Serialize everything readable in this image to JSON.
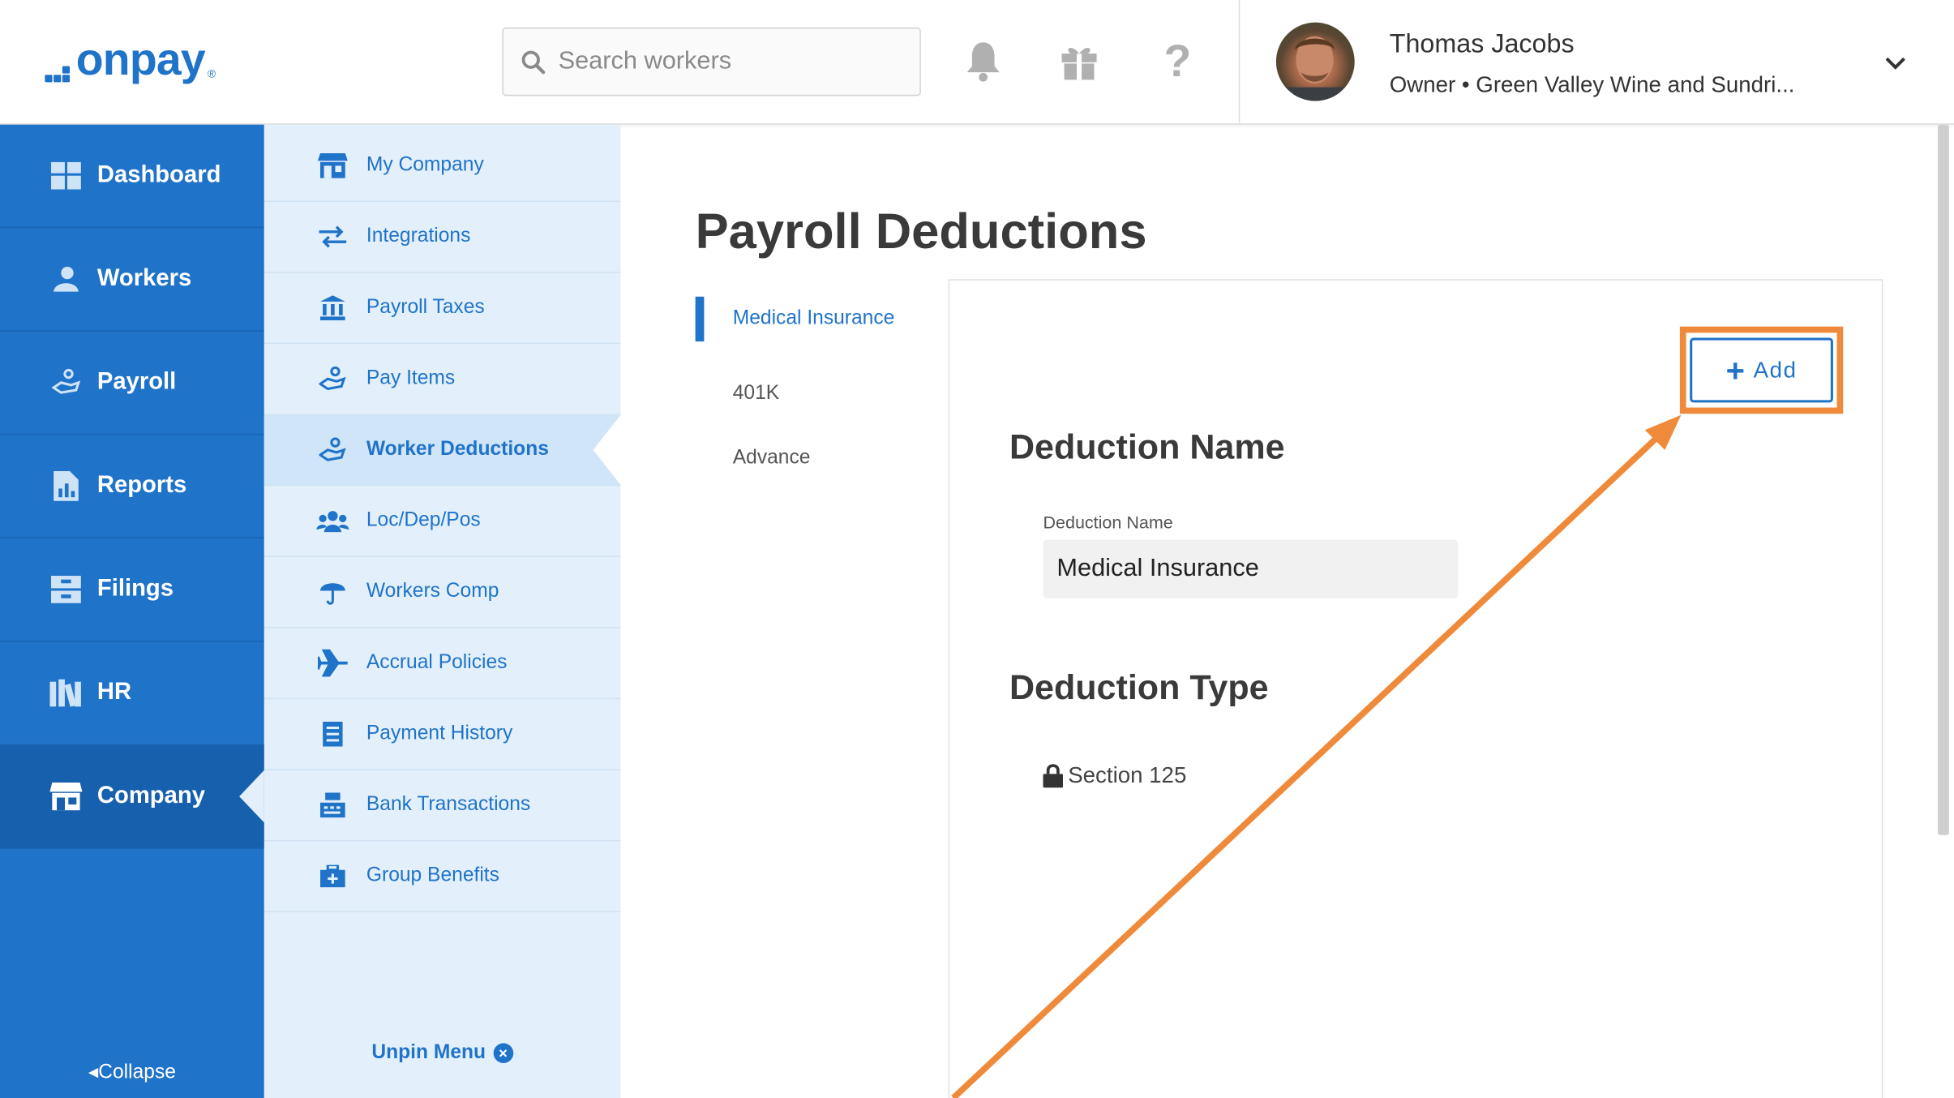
{
  "brand": {
    "logo_text": "onpay",
    "logo_mark": "®"
  },
  "header": {
    "search_placeholder": "Search workers",
    "icons": [
      "bell-icon",
      "gift-icon",
      "help-icon"
    ],
    "help_symbol": "?",
    "user": {
      "name": "Thomas Jacobs",
      "role": "Owner • Green Valley Wine and Sundri..."
    }
  },
  "nav": {
    "items": [
      {
        "label": "Dashboard",
        "icon": "dashboard-icon"
      },
      {
        "label": "Workers",
        "icon": "workers-icon"
      },
      {
        "label": "Payroll",
        "icon": "payroll-icon"
      },
      {
        "label": "Reports",
        "icon": "reports-icon"
      },
      {
        "label": "Filings",
        "icon": "filings-icon"
      },
      {
        "label": "HR",
        "icon": "hr-icon"
      },
      {
        "label": "Company",
        "icon": "company-icon"
      }
    ],
    "active": "Company",
    "collapse_label": "Collapse"
  },
  "submenu": {
    "items": [
      {
        "label": "My Company",
        "icon": "store-icon"
      },
      {
        "label": "Integrations",
        "icon": "arrows-icon"
      },
      {
        "label": "Payroll Taxes",
        "icon": "bank-icon"
      },
      {
        "label": "Pay Items",
        "icon": "hand-coin-icon"
      },
      {
        "label": "Worker Deductions",
        "icon": "hand-coin-icon"
      },
      {
        "label": "Loc/Dep/Pos",
        "icon": "users-icon"
      },
      {
        "label": "Workers Comp",
        "icon": "umbrella-icon"
      },
      {
        "label": "Accrual Policies",
        "icon": "plane-icon"
      },
      {
        "label": "Payment History",
        "icon": "receipt-icon"
      },
      {
        "label": "Bank Transactions",
        "icon": "register-icon"
      },
      {
        "label": "Group Benefits",
        "icon": "medkit-icon"
      }
    ],
    "active": "Worker Deductions",
    "unpin_label": "Unpin Menu",
    "unpin_symbol": "×"
  },
  "main": {
    "title": "Payroll Deductions",
    "tabs": [
      "Medical Insurance",
      "401K",
      "Advance"
    ],
    "active_tab": "Medical Insurance",
    "add_label": "Add",
    "add_symbol": "+",
    "deduction_name_heading": "Deduction Name",
    "deduction_name_label": "Deduction Name",
    "deduction_name_value": "Medical Insurance",
    "deduction_type_heading": "Deduction Type",
    "deduction_type_value": "Section 125"
  },
  "colors": {
    "brand_blue": "#1f73c9",
    "nav_active": "#1760ad",
    "submenu_bg": "#e3f0fc",
    "annotation_orange": "#ef8a3a"
  }
}
